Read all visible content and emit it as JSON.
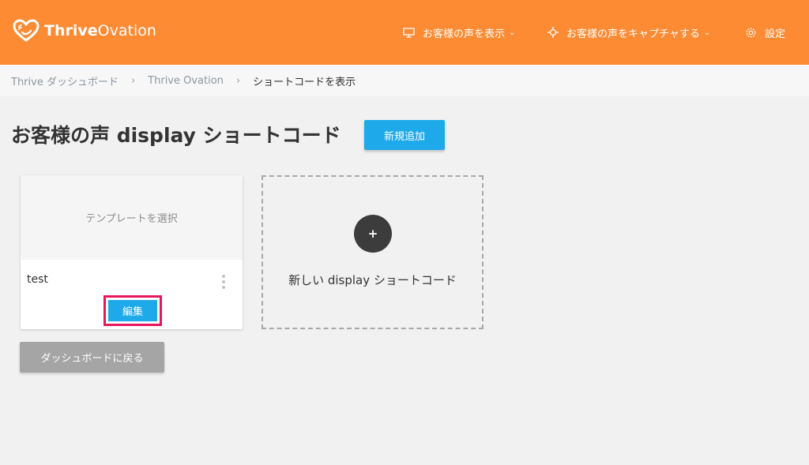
{
  "header": {
    "logo": {
      "word1": "Thrive",
      "word2": "Ovation"
    },
    "nav": [
      {
        "label": "お客様の声を表示",
        "icon": "monitor-icon"
      },
      {
        "label": "お客様の声をキャプチャする",
        "icon": "crosshair-icon"
      },
      {
        "label": "設定",
        "icon": "gear-icon"
      }
    ],
    "colors": {
      "header_bg": "#fd8b33",
      "accent": "#1eaaea",
      "highlight": "#e8175d"
    }
  },
  "breadcrumb": {
    "items": [
      "Thrive ダッシュボード",
      "Thrive Ovation",
      "ショートコードを表示"
    ],
    "separator": "›"
  },
  "main": {
    "title": "お客様の声 display ショートコード",
    "add_button": "新規追加",
    "card": {
      "preview_text": "テンプレートを選択",
      "name": "test",
      "edit_button": "編集"
    },
    "new_card": {
      "plus": "+",
      "label": "新しい display ショートコード"
    },
    "back_button": "ダッシュボードに戻る"
  }
}
